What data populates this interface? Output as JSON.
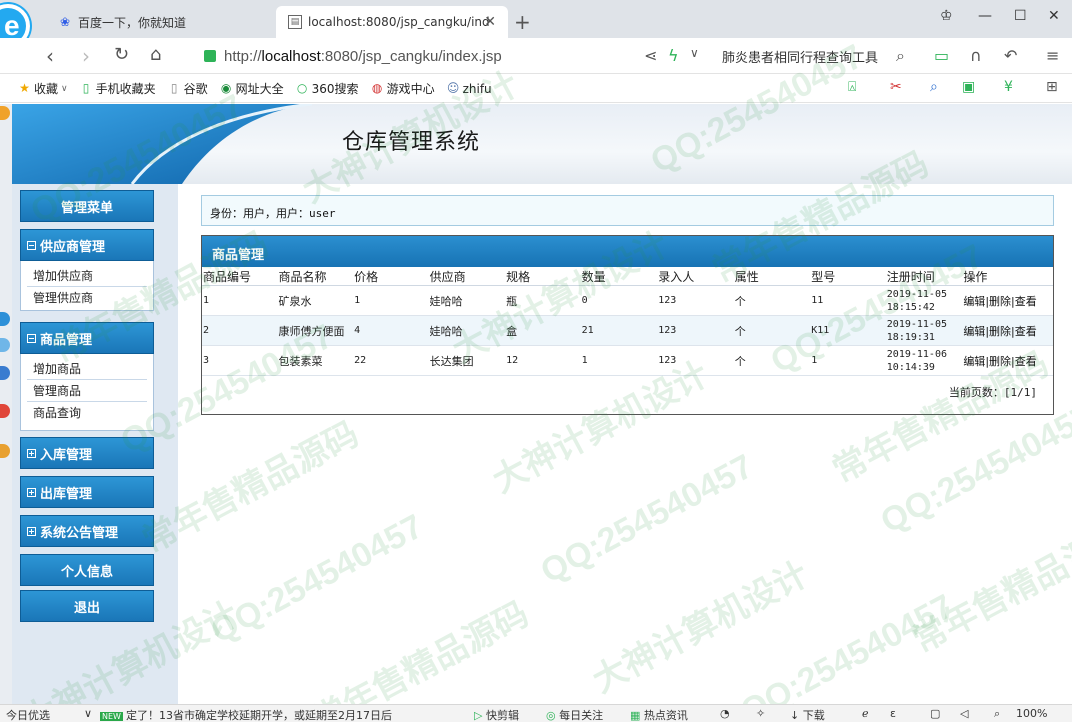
{
  "browser": {
    "tabs": [
      {
        "title": "百度一下，你就知道",
        "active": false,
        "favicon": "paw-icon"
      },
      {
        "title": "localhost:8080/jsp_cangku/ind",
        "active": true,
        "favicon": "document-icon"
      }
    ],
    "url_prefix": "http://",
    "url_host": "localhost",
    "url_rest": ":8080/jsp_cangku/index.jsp",
    "search_text": "肺炎患者相同行程查询工具",
    "bookmarks": [
      "收藏",
      "手机收藏夹",
      "谷歌",
      "网址大全",
      "360搜索",
      "游戏中心",
      "zhifu"
    ]
  },
  "app": {
    "title": "仓库管理系统"
  },
  "menu": {
    "header": "管理菜单",
    "groups": [
      {
        "label": "供应商管理",
        "expanded": true,
        "items": [
          "增加供应商",
          "管理供应商"
        ]
      },
      {
        "label": "商品管理",
        "expanded": true,
        "items": [
          "增加商品",
          "管理商品",
          "商品查询"
        ]
      },
      {
        "label": "入库管理",
        "expanded": false,
        "items": []
      },
      {
        "label": "出库管理",
        "expanded": false,
        "items": []
      },
      {
        "label": "系统公告管理",
        "expanded": false,
        "items": []
      }
    ],
    "personal": "个人信息",
    "logout": "退出"
  },
  "identity": "身份：用户，用户：user",
  "panel": {
    "title": "商品管理",
    "columns": [
      "商品编号",
      "商品名称",
      "价格",
      "供应商",
      "规格",
      "数量",
      "录入人",
      "属性",
      "型号",
      "注册时间",
      "操作"
    ],
    "rows": [
      {
        "id": "1",
        "name": "矿泉水",
        "price": "1",
        "supplier": "娃哈哈",
        "spec": "瓶",
        "qty": "0",
        "creator": "123",
        "unit": "个",
        "model": "11",
        "date": "2019-11-05",
        "time": "18:15:42"
      },
      {
        "id": "2",
        "name": "康师傅方便面",
        "price": "4",
        "supplier": "娃哈哈",
        "spec": "盒",
        "qty": "21",
        "creator": "123",
        "unit": "个",
        "model": "K11",
        "date": "2019-11-05",
        "time": "18:19:31"
      },
      {
        "id": "3",
        "name": "包装素菜",
        "price": "22",
        "supplier": "长达集团",
        "spec": "12",
        "qty": "1",
        "creator": "123",
        "unit": "个",
        "model": "1",
        "date": "2019-11-06",
        "time": "10:14:39"
      }
    ],
    "ops": {
      "edit": "编辑",
      "delete": "|删除",
      "view": "|查看"
    },
    "pager": "当前页数：[1/1]"
  },
  "statusbar": {
    "left": "今日优选",
    "badge": "NEW",
    "news": "定了！13省市确定学校延期开学，或延期至2月17日后",
    "items": [
      "快剪辑",
      "每日关注",
      "热点资讯",
      "下载",
      "100%"
    ]
  },
  "watermarks": [
    "QQ:254540457",
    "常年售精品源码",
    "大神计算机设计"
  ],
  "colors": {
    "accent": "#1a7ec2",
    "menu_bg": "#dfe8f2",
    "watermark": "#2c963c"
  }
}
